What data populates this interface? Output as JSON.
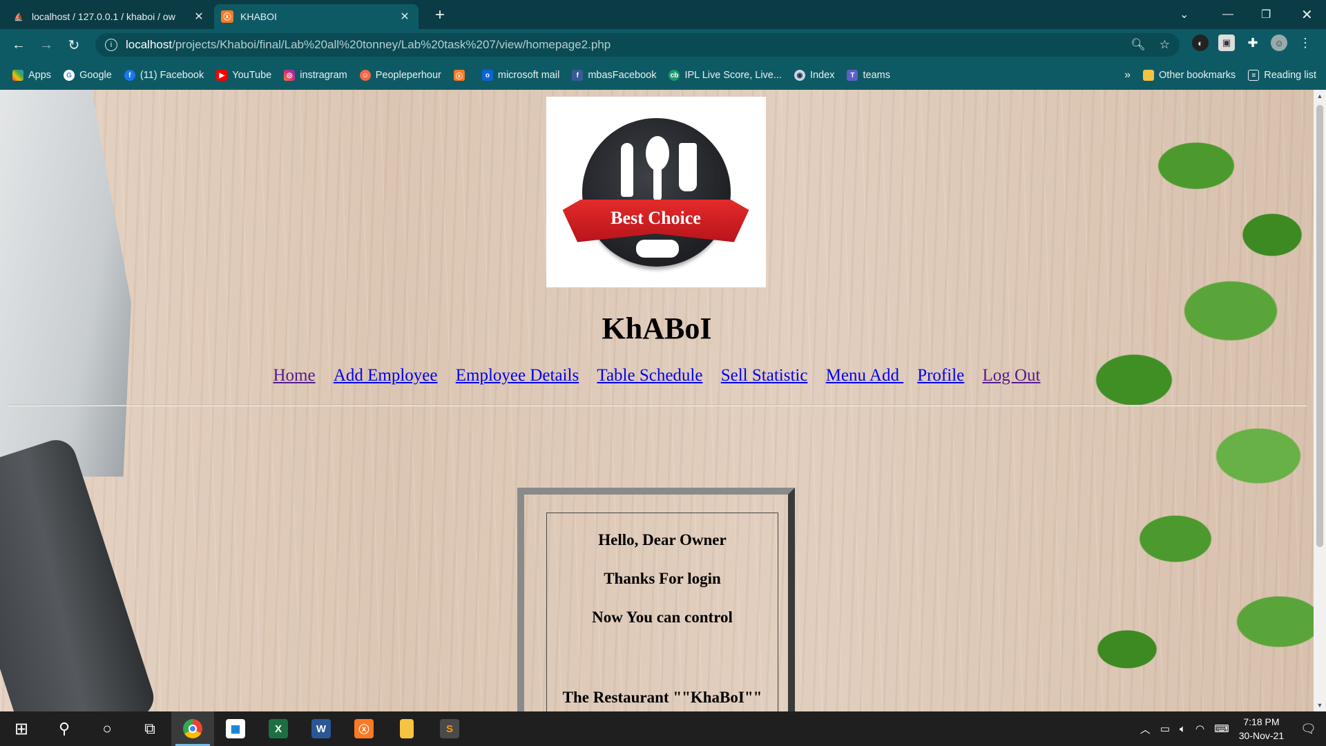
{
  "browser": {
    "tabs": [
      {
        "title": "localhost / 127.0.0.1 / khaboi / ow",
        "icon": "phpmyadmin-icon",
        "active": false
      },
      {
        "title": "KHABOI",
        "icon": "xampp-icon",
        "active": true
      }
    ],
    "url_host": "localhost",
    "url_path": "/projects/Khaboi/final/Lab%20all%20tonney/Lab%20task%207/view/homepage2.php",
    "bookmarks": [
      {
        "label": "Apps",
        "icon": "apps-grid-icon"
      },
      {
        "label": "Google",
        "icon": "google-icon"
      },
      {
        "label": "(11) Facebook",
        "icon": "facebook-icon"
      },
      {
        "label": "YouTube",
        "icon": "youtube-icon"
      },
      {
        "label": "instragram",
        "icon": "instagram-icon"
      },
      {
        "label": "Peopleperhour",
        "icon": "peopleperhour-icon"
      },
      {
        "label": "",
        "icon": "xampp-icon"
      },
      {
        "label": "microsoft mail",
        "icon": "outlook-icon"
      },
      {
        "label": "mbasFacebook",
        "icon": "facebook-icon"
      },
      {
        "label": "IPL Live Score, Live...",
        "icon": "cricbuzz-icon"
      },
      {
        "label": "Index",
        "icon": "index-icon"
      },
      {
        "label": "teams",
        "icon": "teams-icon"
      }
    ],
    "other_bookmarks": "Other bookmarks",
    "reading_list": "Reading list"
  },
  "page": {
    "logo_text": "Best Choice",
    "site_title": "KhABoI",
    "nav": [
      {
        "label": "Home",
        "visited": true
      },
      {
        "label": "Add Employee",
        "visited": false
      },
      {
        "label": "Employee Details",
        "visited": false
      },
      {
        "label": "Table Schedule",
        "visited": false
      },
      {
        "label": "Sell Statistic",
        "visited": false
      },
      {
        "label": "Menu Add ",
        "visited": false
      },
      {
        "label": "Profile",
        "visited": false
      },
      {
        "label": "Log Out",
        "visited": true
      }
    ],
    "welcome": {
      "line1": "Hello, Dear Owner",
      "line2": "Thanks For login",
      "line3": "Now You can control",
      "line4": "The Restaurant \"\"KhaBoI\"\""
    }
  },
  "taskbar": {
    "time": "7:18 PM",
    "date": "30-Nov-21"
  },
  "colors": {
    "chrome_frame": "#0b3b44",
    "chrome_toolbar": "#0e5a64",
    "link": "#0000ee",
    "link_visited": "#551a8b",
    "ribbon_red": "#d42026"
  }
}
